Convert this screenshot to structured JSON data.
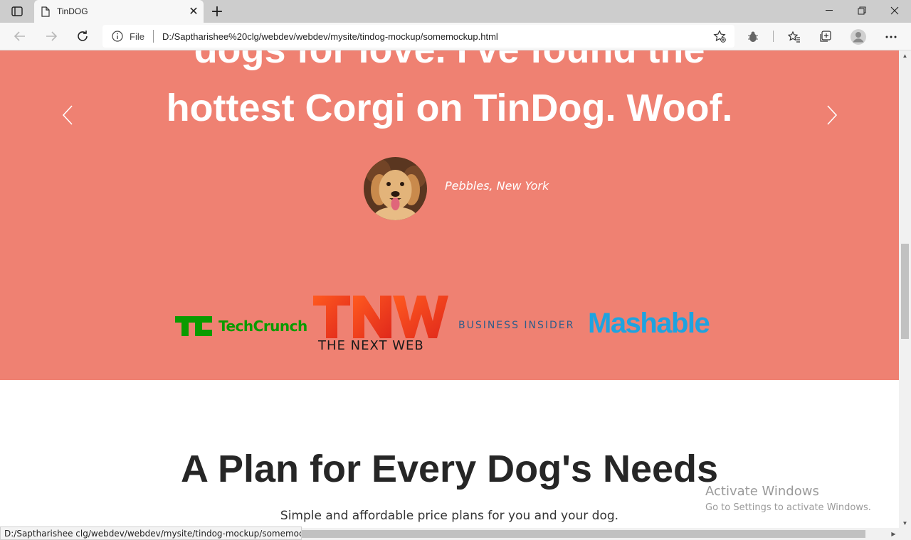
{
  "browser": {
    "tab_title": "TinDOG",
    "tab_close": "✕",
    "new_tab": "+",
    "address_prefix": "File",
    "url": "D:/Saptharishee%20clg/webdev/webdev/mysite/tindog-mockup/somemockup.html",
    "status_url": "D:/Saptharishee clg/webdev/webdev/mysite/tindog-mockup/somemockup...."
  },
  "testimonial": {
    "quote_line1": "dogs for love. I've found the",
    "quote_line2": "hottest Corgi on TinDog. Woof.",
    "author": "Pebbles, New York"
  },
  "press": {
    "techcrunch": "TechCrunch",
    "tnw_tagline": "THE NEXT WEB",
    "business_insider": "BUSINESS INSIDER",
    "mashable": "Mashable",
    "colors": {
      "techcrunch": "#0a9b00",
      "tnw": "#ff4d1a",
      "business_insider": "#2f5d8a",
      "mashable": "#1ea3e0"
    }
  },
  "pricing": {
    "title": "A Plan for Every Dog's Needs",
    "subtitle": "Simple and affordable price plans for you and your dog."
  },
  "watermark": {
    "line1": "Activate Windows",
    "line2": "Go to Settings to activate Windows."
  },
  "colors": {
    "testimonial_bg": "#ef8172"
  },
  "icons": [
    "tab-actions-icon",
    "page-icon",
    "close-icon",
    "plus-icon",
    "minimize-icon",
    "restore-icon",
    "window-close-icon",
    "back-icon",
    "forward-icon",
    "refresh-icon",
    "info-icon",
    "add-favorite-icon",
    "extension-icon",
    "favorites-icon",
    "collections-icon",
    "profile-icon",
    "more-icon",
    "chevron-left-icon",
    "chevron-right-icon"
  ]
}
